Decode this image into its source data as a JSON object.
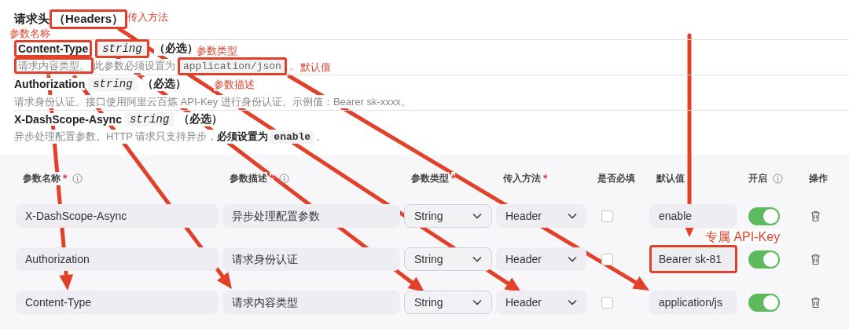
{
  "doc": {
    "title": "请求头",
    "title_note": "（Headers）",
    "title_note_highlight": true,
    "params": [
      {
        "name": "Content-Type",
        "name_highlight": true,
        "type": "string",
        "type_highlight": true,
        "required": "（必选）",
        "description": [
          {
            "kind": "text",
            "text": "请求内容类型。",
            "highlight": true
          },
          {
            "kind": "text",
            "text": "此参数必须设置为",
            "highlight": false
          },
          {
            "kind": "code",
            "text": "application/json",
            "highlight": true
          },
          {
            "kind": "text",
            "text": "。",
            "highlight": false
          }
        ]
      },
      {
        "name": "Authorization",
        "name_highlight": false,
        "type": "string",
        "type_highlight": false,
        "required": "（必选）",
        "description": [
          {
            "kind": "text",
            "text": "请求身份认证。接口使用阿里云百炼 API-Key 进行身份认证。示例值：Bearer sk-xxxx。",
            "highlight": false
          }
        ]
      },
      {
        "name": "X-DashScope-Async",
        "name_highlight": false,
        "type": "string",
        "type_highlight": false,
        "required": "（必选）",
        "description": [
          {
            "kind": "text",
            "text": "异步处理配置参数。HTTP 请求只支持异步，",
            "highlight": false
          },
          {
            "kind": "bold",
            "text": "必须设置为",
            "highlight": false
          },
          {
            "kind": "code",
            "text": "enable",
            "highlight": false
          },
          {
            "kind": "text",
            "text": "。",
            "highlight": false
          }
        ]
      }
    ]
  },
  "table": {
    "columns": [
      {
        "label": "参数名称",
        "mark": "*",
        "info": true
      },
      {
        "label": "参数描述",
        "mark": "*",
        "info": true
      },
      {
        "label": "参数类型",
        "mark": "*"
      },
      {
        "label": "传入方法",
        "mark": "*"
      },
      {
        "label": "是否必填"
      },
      {
        "label": "默认值"
      },
      {
        "label": "开启",
        "info": true
      },
      {
        "label": "操作"
      }
    ],
    "rows": [
      {
        "name": "X-DashScope-Async",
        "description": "异步处理配置参数",
        "type": "String",
        "method": "Header",
        "required": false,
        "default": "enable",
        "default_highlight": false,
        "on": true
      },
      {
        "name": "Authorization",
        "description": "请求身份认证",
        "type": "String",
        "method": "Header",
        "required": false,
        "default": "Bearer sk-81",
        "default_highlight": true,
        "on": true
      },
      {
        "name": "Content-Type",
        "description": "请求内容类型",
        "type": "String",
        "method": "Header",
        "required": false,
        "default": "application/js",
        "default_highlight": false,
        "on": true
      }
    ]
  },
  "annotations": [
    {
      "text": "传入方法"
    },
    {
      "text": "参数名称"
    },
    {
      "text": "参数类型"
    },
    {
      "text": "默认值"
    },
    {
      "text": "参数描述"
    },
    {
      "text": "专属 API-Key"
    }
  ]
}
